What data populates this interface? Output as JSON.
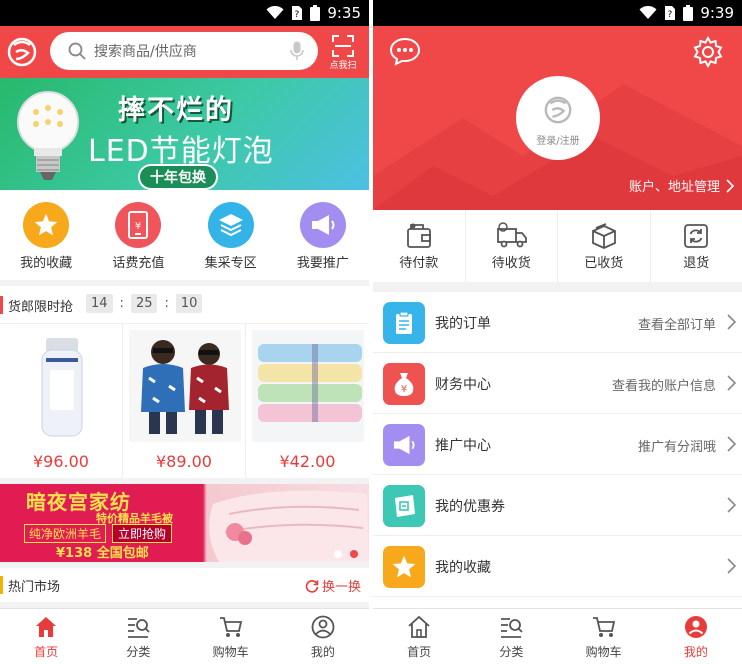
{
  "left": {
    "status_bar": {
      "time": "9:35"
    },
    "header": {
      "search_placeholder": "搜索商品/供应商",
      "scan_label": "点我扫"
    },
    "banner": {
      "headline": "摔不烂的",
      "subheadline": "LED节能灯泡",
      "tag": "十年包换",
      "slide_count": 5,
      "active_slide": 4
    },
    "quick_nav": [
      {
        "label": "我的收藏",
        "icon": "star-icon",
        "color": "#f7a81b"
      },
      {
        "label": "话费充值",
        "icon": "phone-recharge-icon",
        "color": "#f0555b"
      },
      {
        "label": "集采专区",
        "icon": "layers-icon",
        "color": "#33b3e8"
      },
      {
        "label": "我要推广",
        "icon": "megaphone-icon",
        "color": "#a48df0"
      }
    ],
    "flash_sale": {
      "title": "货郎限时抢",
      "timer": {
        "hours": "14",
        "minutes": "25",
        "seconds": "10",
        "separator": ":"
      },
      "products": [
        {
          "price": "¥96.00",
          "image": "lotion-bottle"
        },
        {
          "price": "¥89.00",
          "image": "kids-jackets"
        },
        {
          "price": "¥42.00",
          "image": "towel-stack"
        }
      ]
    },
    "promo_banner": {
      "brand": "暗夜宫家纺",
      "slogan": "特价精品羊毛被",
      "tag1": "纯净欧洲羊毛",
      "tag2": "立即抢购",
      "price_line": "¥138 全国包邮",
      "slide_count": 2,
      "active_slide": 2
    },
    "hot_market": {
      "title": "热门市场",
      "refresh_label": "换一换"
    },
    "bottom_nav": [
      {
        "label": "首页",
        "icon": "home-icon",
        "active": true
      },
      {
        "label": "分类",
        "icon": "category-icon",
        "active": false
      },
      {
        "label": "购物车",
        "icon": "cart-icon",
        "active": false
      },
      {
        "label": "我的",
        "icon": "user-icon",
        "active": false
      }
    ]
  },
  "right": {
    "status_bar": {
      "time": "9:39"
    },
    "profile": {
      "login_label": "登录/注册",
      "account_link": "账户、地址管理"
    },
    "order_status": [
      {
        "label": "待付款",
        "icon": "wallet-icon"
      },
      {
        "label": "待收货",
        "icon": "truck-icon"
      },
      {
        "label": "已收货",
        "icon": "box-icon"
      },
      {
        "label": "退货",
        "icon": "return-icon"
      }
    ],
    "menu": [
      {
        "title": "我的订单",
        "hint": "查看全部订单",
        "icon": "order-list-icon",
        "color": "#37b5ea"
      },
      {
        "title": "财务中心",
        "hint": "查看我的账户信息",
        "icon": "money-bag-icon",
        "color": "#ef5350"
      },
      {
        "title": "推广中心",
        "hint": "推广有分润哦",
        "icon": "megaphone-icon",
        "color": "#a48df0"
      },
      {
        "title": "我的优惠券",
        "hint": "",
        "icon": "coupon-icon",
        "color": "#3cc8b4"
      },
      {
        "title": "我的收藏",
        "hint": "",
        "icon": "star-icon",
        "color": "#f7a81b"
      }
    ],
    "bottom_nav": [
      {
        "label": "首页",
        "icon": "home-icon",
        "active": false
      },
      {
        "label": "分类",
        "icon": "category-icon",
        "active": false
      },
      {
        "label": "购物车",
        "icon": "cart-icon",
        "active": false
      },
      {
        "label": "我的",
        "icon": "user-icon",
        "active": true
      }
    ]
  },
  "colors": {
    "brand_red": "#f04848",
    "price_red": "#e83b3b",
    "hot_market_accent": "#f2b400"
  }
}
